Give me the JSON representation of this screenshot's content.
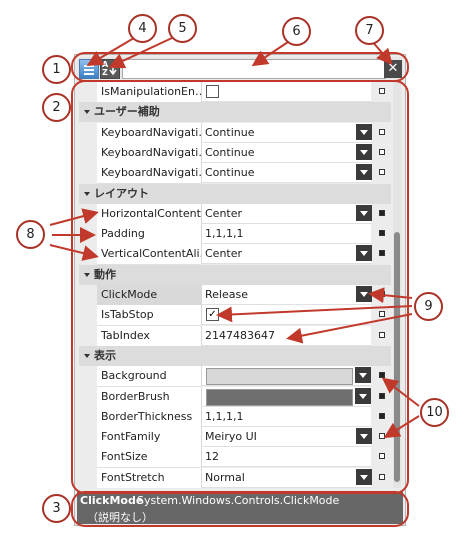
{
  "toolbar": {
    "az_top": "A",
    "az_bottom": "Z",
    "search_value": "",
    "clear_glyph": "✕"
  },
  "sections": [
    {
      "type": "row",
      "name": "IsManipulationEn…",
      "kind": "checkbox",
      "checked": false,
      "marker": "empty"
    },
    {
      "type": "cat",
      "label": "ユーザー補助"
    },
    {
      "type": "row",
      "name": "KeyboardNavigati…",
      "value": "Continue",
      "kind": "dropdown",
      "marker": "empty"
    },
    {
      "type": "row",
      "name": "KeyboardNavigati…",
      "value": "Continue",
      "kind": "dropdown",
      "marker": "empty"
    },
    {
      "type": "row",
      "name": "KeyboardNavigati…",
      "value": "Continue",
      "kind": "dropdown",
      "marker": "empty"
    },
    {
      "type": "cat",
      "label": "レイアウト"
    },
    {
      "type": "row",
      "name": "HorizontalContent…",
      "value": "Center",
      "kind": "dropdown",
      "marker": "filled"
    },
    {
      "type": "row",
      "name": "Padding",
      "value": "1,1,1,1",
      "kind": "text",
      "marker": "filled"
    },
    {
      "type": "row",
      "name": "VerticalContentAli…",
      "value": "Center",
      "kind": "dropdown",
      "marker": "filled"
    },
    {
      "type": "cat",
      "label": "動作"
    },
    {
      "type": "row",
      "name": "ClickMode",
      "value": "Release",
      "kind": "dropdown",
      "marker": "empty",
      "selected": true
    },
    {
      "type": "row",
      "name": "IsTabStop",
      "kind": "checkbox",
      "checked": true,
      "marker": "empty"
    },
    {
      "type": "row",
      "name": "TabIndex",
      "value": "2147483647",
      "kind": "text",
      "marker": "empty"
    },
    {
      "type": "cat",
      "label": "表示"
    },
    {
      "type": "row",
      "name": "Background",
      "kind": "color",
      "color": "#d8d8d8",
      "marker": "filled"
    },
    {
      "type": "row",
      "name": "BorderBrush",
      "kind": "color",
      "color": "#6e6e6e",
      "marker": "filled"
    },
    {
      "type": "row",
      "name": "BorderThickness",
      "value": "1,1,1,1",
      "kind": "text",
      "marker": "filled"
    },
    {
      "type": "row",
      "name": "FontFamily",
      "value": "Meiryo UI",
      "kind": "dropdown",
      "marker": "empty"
    },
    {
      "type": "row",
      "name": "FontSize",
      "value": "12",
      "kind": "text",
      "marker": "empty"
    },
    {
      "type": "row",
      "name": "FontStretch",
      "value": "Normal",
      "kind": "dropdown",
      "marker": "empty"
    }
  ],
  "description": {
    "name": "ClickMode",
    "type": "System.Windows.Controls.ClickMode",
    "text": "（説明なし）"
  },
  "annotations": [
    "1",
    "2",
    "3",
    "4",
    "5",
    "6",
    "7",
    "8",
    "9",
    "10"
  ],
  "colors": {
    "annotation": "#c0392b",
    "dropdown": "#3a3a3a",
    "description_bg": "#676767"
  }
}
